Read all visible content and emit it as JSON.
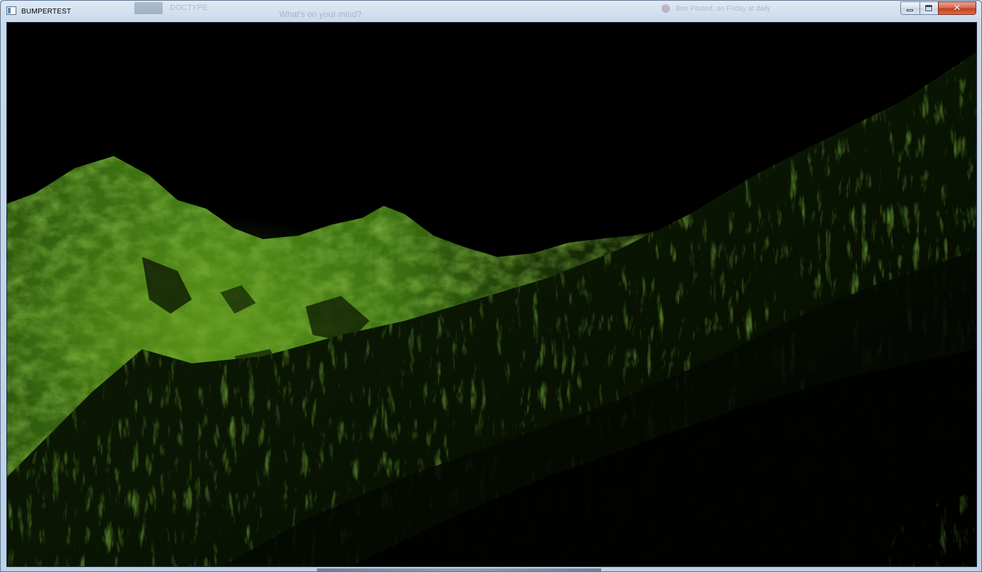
{
  "window": {
    "title": "BUMPERTEST",
    "app_icon": "application-window-icon",
    "buttons": {
      "minimize_icon": "minimize-icon",
      "maximize_icon": "restore-icon",
      "close_icon": "close-icon",
      "close_glyph": "✕"
    }
  },
  "background_window": {
    "label_1": "DOCTYPE",
    "label_2": "What's on your mind?",
    "label_3": "Ben Posted: on Friday at daily"
  },
  "viewport": {
    "content": "3d-terrain-render",
    "terrain_color": "#3a6a12",
    "highlight_color": "#6aa21c",
    "sky_color": "#000000"
  }
}
